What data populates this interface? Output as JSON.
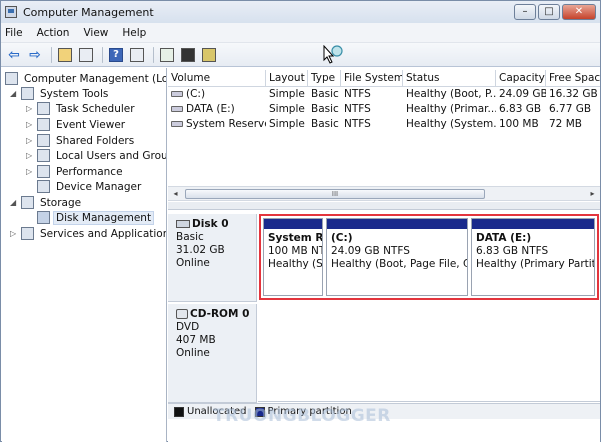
{
  "window": {
    "title": "Computer Management",
    "min": "–",
    "max": "□",
    "close": "✕"
  },
  "menu": [
    "File",
    "Action",
    "View",
    "Help"
  ],
  "toolbar": {
    "back_icon": "⇦",
    "forward_icon": "⇨",
    "help_icon": "?"
  },
  "tree": [
    {
      "label": "Computer Management (Local",
      "twisty": ""
    },
    {
      "label": "System Tools",
      "twisty": "◢"
    },
    {
      "label": "Task Scheduler",
      "twisty": "▷"
    },
    {
      "label": "Event Viewer",
      "twisty": "▷"
    },
    {
      "label": "Shared Folders",
      "twisty": "▷"
    },
    {
      "label": "Local Users and Groups",
      "twisty": "▷"
    },
    {
      "label": "Performance",
      "twisty": "▷"
    },
    {
      "label": "Device Manager",
      "twisty": ""
    },
    {
      "label": "Storage",
      "twisty": "◢"
    },
    {
      "label": "Disk Management",
      "twisty": ""
    },
    {
      "label": "Services and Applications",
      "twisty": "▷"
    }
  ],
  "volume_table": {
    "headers": [
      "Volume",
      "Layout",
      "Type",
      "File System",
      "Status",
      "Capacity",
      "Free Space"
    ],
    "rows": [
      [
        "(C:)",
        "Simple",
        "Basic",
        "NTFS",
        "Healthy (Boot, P...",
        "24.09 GB",
        "16.32 GB"
      ],
      [
        "DATA (E:)",
        "Simple",
        "Basic",
        "NTFS",
        "Healthy (Primar...",
        "6.83 GB",
        "6.77 GB"
      ],
      [
        "System Reserved",
        "Simple",
        "Basic",
        "NTFS",
        "Healthy (System...",
        "100 MB",
        "72 MB"
      ]
    ]
  },
  "scroll": {
    "left": "◂",
    "right": "▸",
    "grip": "III"
  },
  "disk0": {
    "name": "Disk 0",
    "type": "Basic",
    "size": "31.02 GB",
    "status": "Online",
    "partitions": [
      {
        "name": "System Re",
        "size": "100 MB NTI",
        "status": "Healthy (Sy"
      },
      {
        "name": "(C:)",
        "size": "24.09 GB NTFS",
        "status": "Healthy (Boot, Page File, Cra"
      },
      {
        "name": "DATA  (E:)",
        "size": "6.83 GB NTFS",
        "status": "Healthy (Primary Partition"
      }
    ]
  },
  "cdrom0": {
    "name": "CD-ROM 0",
    "type": "DVD",
    "size": "407 MB",
    "status": "Online"
  },
  "legend": {
    "unallocated": "Unallocated",
    "primary": "Primary partition"
  },
  "watermark": "TRUONGBLOGGER"
}
